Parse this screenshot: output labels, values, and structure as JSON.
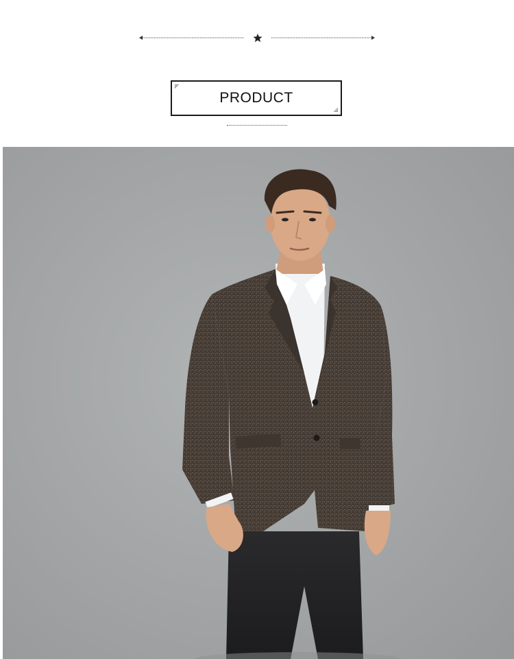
{
  "header": {
    "ornament_icon": "star-icon",
    "title": "PRODUCT"
  },
  "photo": {
    "subject": "model-wearing-tweed-blazer",
    "colors": {
      "backdrop": "#a4a7a8",
      "blazer": "#4a4039",
      "shirt": "#f2f3f5",
      "trousers": "#232325",
      "hair": "#3a2a20",
      "skin": "#d9a887"
    }
  }
}
